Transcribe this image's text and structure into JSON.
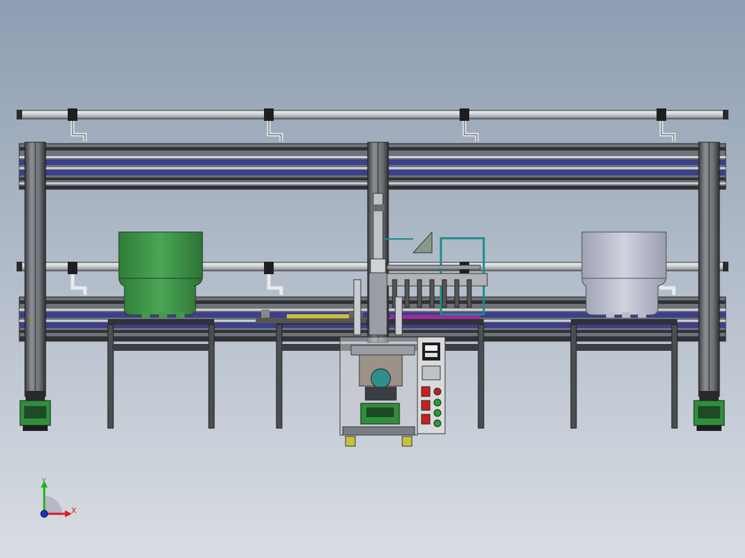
{
  "scene": {
    "background_top": "#8d9db1",
    "background_bottom": "#d9dde3",
    "frame_color": "#6f7377",
    "frame_dark": "#2f3236",
    "rail_accent": "#3c3f8a",
    "pipe_color": "#d8dbdf",
    "bowl_left_color": "#3f9a4a",
    "bowl_right_color": "#b8bccb",
    "foot_color": "#2f8f3c",
    "highlight_yellow": "#c8c03a",
    "highlight_magenta": "#a02a9a",
    "highlight_teal": "#1f8a8a"
  },
  "components": {
    "top_pipe": "pipe",
    "upper_beam": "aluminum-extrusion-beam",
    "lower_beam": "aluminum-extrusion-beam",
    "left_post": "support-post",
    "center_post": "support-post",
    "right_post": "support-post",
    "left_bowl_feeder": "vibratory-bowl-feeder",
    "right_bowl_feeder": "vibratory-bowl-feeder",
    "central_press": "press-station",
    "control_panel": "control-panel",
    "leveling_feet": "leveling-feet"
  },
  "triad": {
    "x_label": "X",
    "y_label": "Y",
    "x_color": "#d42020",
    "y_color": "#20b020",
    "z_color": "#2030c0"
  }
}
